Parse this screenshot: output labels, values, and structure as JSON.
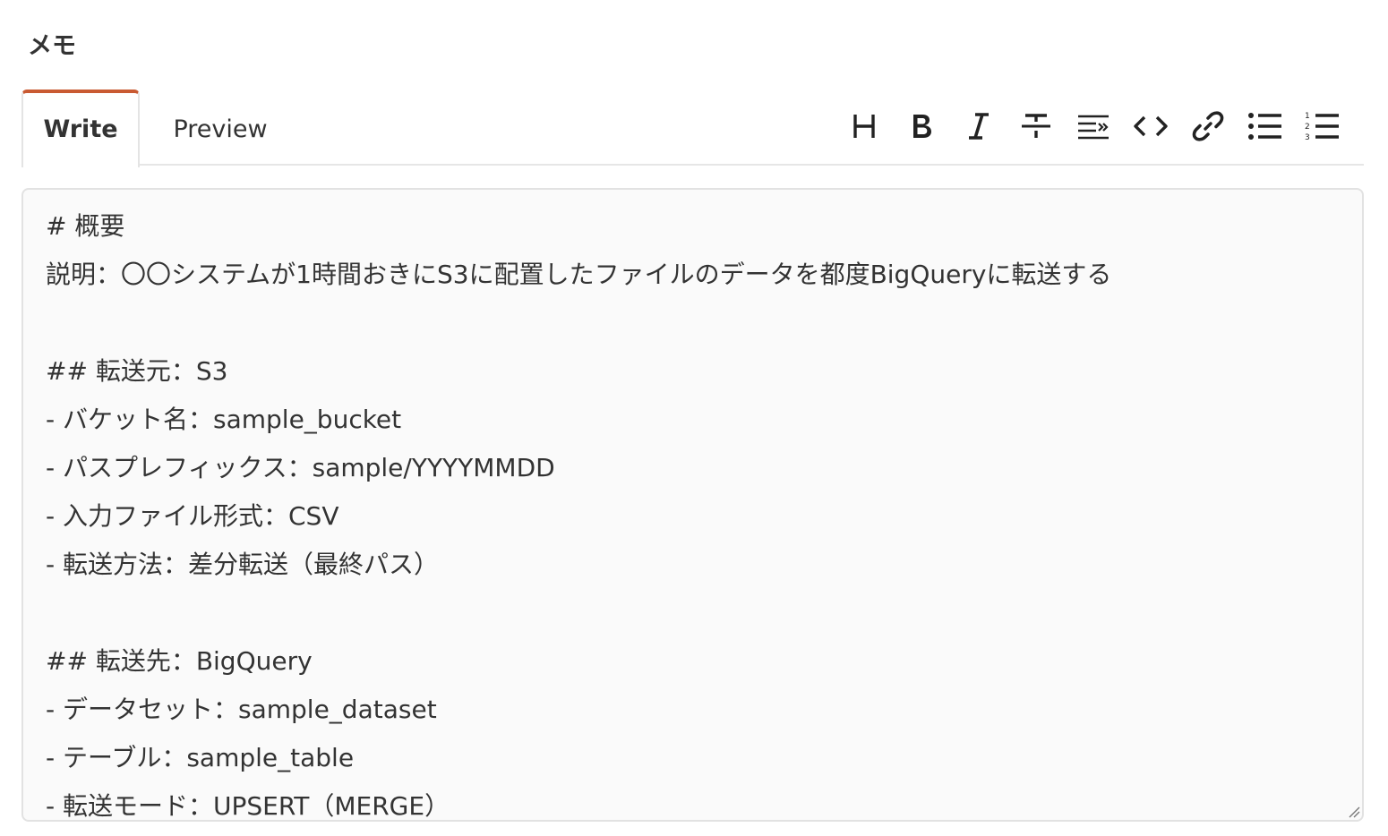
{
  "section": {
    "title": "メモ"
  },
  "tabs": [
    {
      "label": "Write",
      "active": true
    },
    {
      "label": "Preview",
      "active": false
    }
  ],
  "toolbar": {
    "buttons": [
      {
        "name": "heading-icon",
        "glyph": "H"
      },
      {
        "name": "bold-icon",
        "glyph": "B"
      },
      {
        "name": "italic-icon",
        "glyph": "I"
      },
      {
        "name": "strikethrough-icon",
        "glyph": "S"
      },
      {
        "name": "quote-icon",
        "glyph": "quote"
      },
      {
        "name": "code-icon",
        "glyph": "code"
      },
      {
        "name": "link-icon",
        "glyph": "link"
      },
      {
        "name": "bullet-list-icon",
        "glyph": "ul"
      },
      {
        "name": "numbered-list-icon",
        "glyph": "ol"
      }
    ]
  },
  "editor": {
    "lines": [
      "# 概要",
      "説明：〇〇システムが1時間おきにS3に配置したファイルのデータを都度BigQueryに転送する",
      "",
      "## 転送元：S3",
      "- バケット名：sample_bucket",
      "- パスプレフィックス：sample/YYYYMMDD",
      "- 入力ファイル形式：CSV",
      "- 転送方法：差分転送（最終パス）",
      "",
      "## 転送先：BigQuery",
      "- データセット：sample_dataset",
      "- テーブル：sample_table",
      "- 転送モード：UPSERT（MERGE）"
    ]
  },
  "colors": {
    "active_tab_accent": "#c95a32",
    "editor_background": "#fafafa",
    "text": "#333333"
  }
}
